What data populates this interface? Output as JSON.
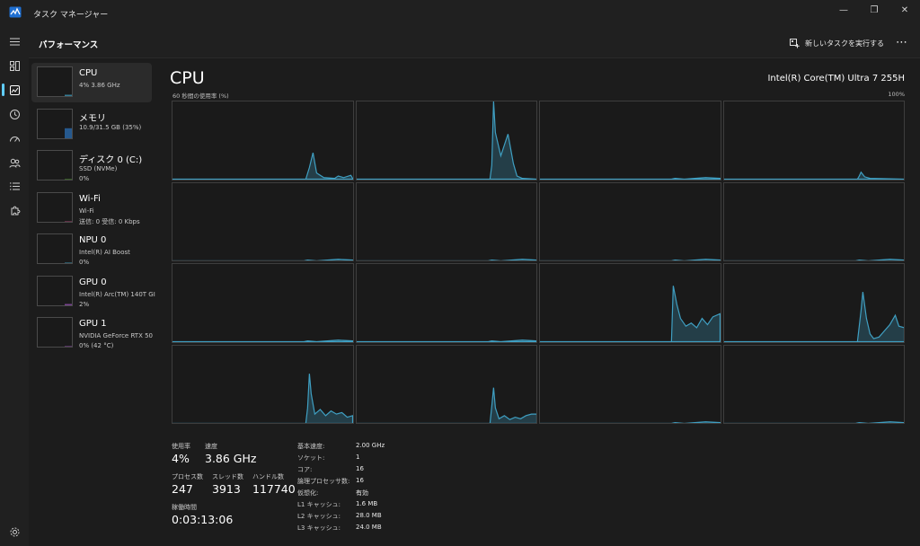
{
  "window": {
    "title": "タスク マネージャー",
    "minimize": "—",
    "maximize": "❐",
    "close": "✕"
  },
  "header": {
    "page_title": "パフォーマンス",
    "run_task_label": "新しいタスクを実行する",
    "more_label": "⋯"
  },
  "resources": [
    {
      "name": "CPU",
      "lines": [
        "4%  3.86 GHz"
      ],
      "color": "#3f9fc2",
      "level": 0.04
    },
    {
      "name": "メモリ",
      "lines": [
        "10.9/31.5 GB (35%)"
      ],
      "color": "#2b6fb5",
      "level": 0.35
    },
    {
      "name": "ディスク 0 (C:)",
      "lines": [
        "SSD (NVMe)",
        "0%"
      ],
      "color": "#5aa832",
      "level": 0.0
    },
    {
      "name": "Wi-Fi",
      "lines": [
        "Wi-Fi",
        "送信: 0  受信: 0 Kbps"
      ],
      "color": "#b0487a",
      "level": 0.0
    },
    {
      "name": "NPU 0",
      "lines": [
        "Intel(R) AI Boost",
        "0%"
      ],
      "color": "#3f9fc2",
      "level": 0.0
    },
    {
      "name": "GPU 0",
      "lines": [
        "Intel(R) Arc(TM) 140T GI",
        "2%"
      ],
      "color": "#9a4fb8",
      "level": 0.02
    },
    {
      "name": "GPU 1",
      "lines": [
        "NVIDIA GeForce RTX 50",
        "0%  (42 °C)"
      ],
      "color": "#9a4fb8",
      "level": 0.0
    }
  ],
  "main": {
    "title": "CPU",
    "model": "Intel(R) Core(TM) Ultra 7 255H",
    "graph_caption": "60 秒間の使用率 (%)",
    "graph_max": "100%",
    "graph_color": "#3f9fc2",
    "logical_processor_graphs": 16,
    "stats": {
      "usage_label": "使用率",
      "usage_value": "4%",
      "speed_label": "速度",
      "speed_value": "3.86 GHz",
      "processes_label": "プロセス数",
      "processes_value": "247",
      "threads_label": "スレッド数",
      "threads_value": "3913",
      "handles_label": "ハンドル数",
      "handles_value": "117740",
      "uptime_label": "稼働時間",
      "uptime_value": "0:03:13:06"
    },
    "specs": [
      {
        "key": "基本速度:",
        "value": "2.00 GHz"
      },
      {
        "key": "ソケット:",
        "value": "1"
      },
      {
        "key": "コア:",
        "value": "16"
      },
      {
        "key": "論理プロセッサ数:",
        "value": "16"
      },
      {
        "key": "仮想化:",
        "value": "有効"
      },
      {
        "key": "L1 キャッシュ:",
        "value": "1.6 MB"
      },
      {
        "key": "L2 キャッシュ:",
        "value": "28.0 MB"
      },
      {
        "key": "L3 キャッシュ:",
        "value": "24.0 MB"
      }
    ]
  }
}
